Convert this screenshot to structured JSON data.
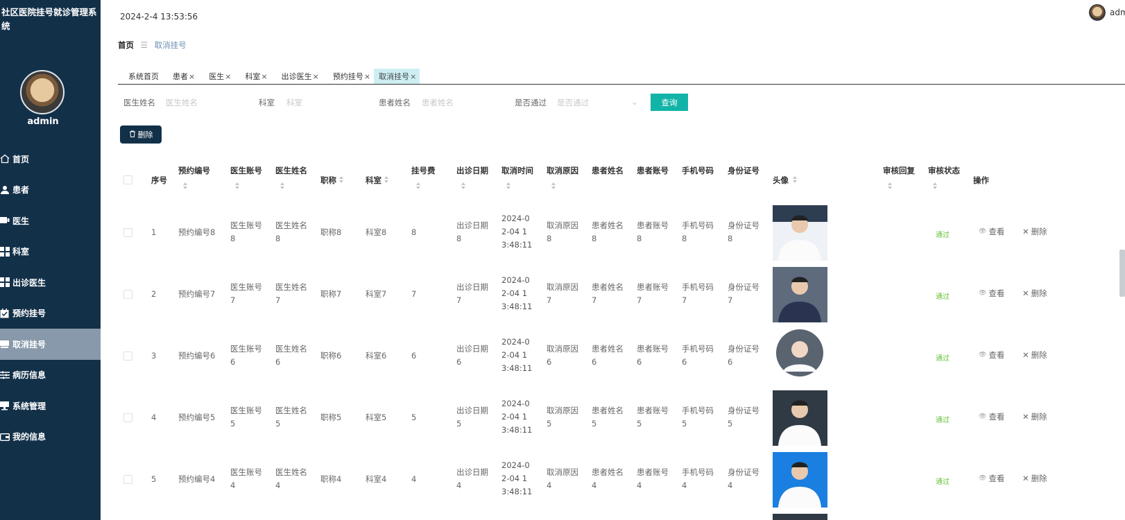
{
  "app": {
    "title": "社区医院挂号就诊管理系统"
  },
  "sidebar": {
    "username": "admin",
    "items": [
      {
        "label": "首页",
        "icon": "home-icon"
      },
      {
        "label": "患者",
        "icon": "user-icon"
      },
      {
        "label": "医生",
        "icon": "doctor-icon"
      },
      {
        "label": "科室",
        "icon": "grid-icon"
      },
      {
        "label": "出诊医生",
        "icon": "grid-icon"
      },
      {
        "label": "预约挂号",
        "icon": "calendar-check-icon"
      },
      {
        "label": "取消挂号",
        "icon": "monitor-icon",
        "active": true
      },
      {
        "label": "病历信息",
        "icon": "sliders-icon"
      },
      {
        "label": "系统管理",
        "icon": "desktop-icon"
      },
      {
        "label": "我的信息",
        "icon": "wallet-icon"
      }
    ]
  },
  "header": {
    "datetime": "2024-2-4 13:53:56",
    "user": "adm"
  },
  "breadcrumb": {
    "home": "首页",
    "separator": "☰",
    "current": "取消挂号"
  },
  "tabs": [
    {
      "label": "系统首页",
      "closable": false
    },
    {
      "label": "患者",
      "closable": true
    },
    {
      "label": "医生",
      "closable": true
    },
    {
      "label": "科室",
      "closable": true
    },
    {
      "label": "出诊医生",
      "closable": true
    },
    {
      "label": "预约挂号",
      "closable": true
    },
    {
      "label": "取消挂号",
      "closable": true,
      "active": true
    }
  ],
  "search": {
    "doctor_name_label": "医生姓名",
    "doctor_name_placeholder": "医生姓名",
    "dept_label": "科室",
    "dept_placeholder": "科室",
    "patient_name_label": "患者姓名",
    "patient_name_placeholder": "患者姓名",
    "approved_label": "是否通过",
    "approved_placeholder": "是否通过",
    "button": "查询"
  },
  "toolbar": {
    "delete_label": "删除"
  },
  "table": {
    "headers": {
      "index": "序号",
      "booking_no": "预约编号",
      "doctor_account": "医生账号",
      "doctor_name": "医生姓名",
      "title": "职称",
      "dept": "科室",
      "fee": "挂号费",
      "visit_date": "出诊日期",
      "cancel_time": "取消时间",
      "cancel_reason": "取消原因",
      "patient_name": "患者姓名",
      "patient_account": "患者账号",
      "phone": "手机号码",
      "id_no": "身份证号",
      "avatar": "头像",
      "review_reply": "审核回复",
      "review_status": "审核状态",
      "actions": "操作"
    },
    "view_label": "查看",
    "delete_label": "删除",
    "rows": [
      {
        "index": "1",
        "booking_no": "预约编号8",
        "doctor_account": "医生账号8",
        "doctor_name": "医生姓名8",
        "title": "职称8",
        "dept": "科室8",
        "fee": "8",
        "visit_date": "出诊日期8",
        "cancel_time": "2024-02-04 13:48:11",
        "cancel_reason": "取消原因8",
        "patient_name": "患者姓名8",
        "patient_account": "患者账号8",
        "phone": "手机号码8",
        "id_no": "身份证号8",
        "status": "通过"
      },
      {
        "index": "2",
        "booking_no": "预约编号7",
        "doctor_account": "医生账号7",
        "doctor_name": "医生姓名7",
        "title": "职称7",
        "dept": "科室7",
        "fee": "7",
        "visit_date": "出诊日期7",
        "cancel_time": "2024-02-04 13:48:11",
        "cancel_reason": "取消原因7",
        "patient_name": "患者姓名7",
        "patient_account": "患者账号7",
        "phone": "手机号码7",
        "id_no": "身份证号7",
        "status": "通过"
      },
      {
        "index": "3",
        "booking_no": "预约编号6",
        "doctor_account": "医生账号6",
        "doctor_name": "医生姓名6",
        "title": "职称6",
        "dept": "科室6",
        "fee": "6",
        "visit_date": "出诊日期6",
        "cancel_time": "2024-02-04 13:48:11",
        "cancel_reason": "取消原因6",
        "patient_name": "患者姓名6",
        "patient_account": "患者账号6",
        "phone": "手机号码6",
        "id_no": "身份证号6",
        "status": "通过"
      },
      {
        "index": "4",
        "booking_no": "预约编号5",
        "doctor_account": "医生账号5",
        "doctor_name": "医生姓名5",
        "title": "职称5",
        "dept": "科室5",
        "fee": "5",
        "visit_date": "出诊日期5",
        "cancel_time": "2024-02-04 13:48:11",
        "cancel_reason": "取消原因5",
        "patient_name": "患者姓名5",
        "patient_account": "患者账号5",
        "phone": "手机号码5",
        "id_no": "身份证号5",
        "status": "通过"
      },
      {
        "index": "5",
        "booking_no": "预约编号4",
        "doctor_account": "医生账号4",
        "doctor_name": "医生姓名4",
        "title": "职称4",
        "dept": "科室4",
        "fee": "4",
        "visit_date": "出诊日期4",
        "cancel_time": "2024-02-04 13:48:11",
        "cancel_reason": "取消原因4",
        "patient_name": "患者姓名4",
        "patient_account": "患者账号4",
        "phone": "手机号码4",
        "id_no": "身份证号4",
        "status": "通过"
      }
    ]
  }
}
